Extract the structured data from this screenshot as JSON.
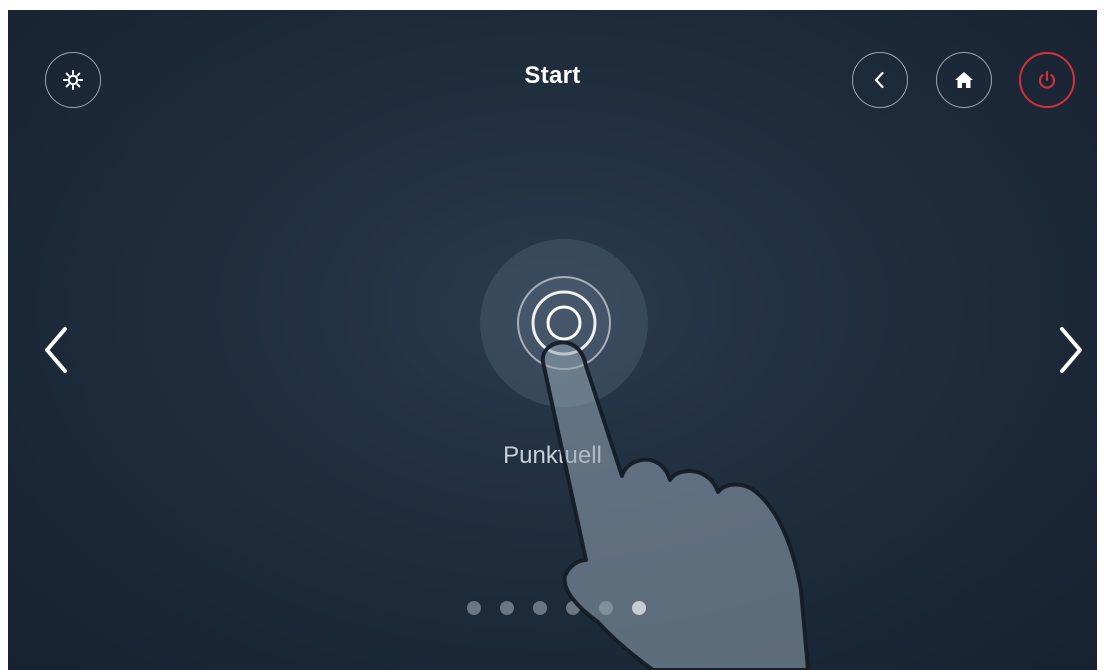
{
  "header": {
    "title": "Start",
    "buttons": {
      "settings": "gear-icon",
      "back": "chevron-left-icon",
      "home": "home-icon",
      "power": "power-icon"
    }
  },
  "carousel": {
    "current_mode": {
      "label": "Punktuell",
      "icon": "target-rings-icon"
    },
    "pager": {
      "total_pages": 6,
      "active_page": 6
    }
  },
  "colors": {
    "background": "#1f2d3d",
    "accent_power": "#d2303c",
    "dot_inactive": "#6c7682",
    "dot_active": "#ffffff"
  }
}
